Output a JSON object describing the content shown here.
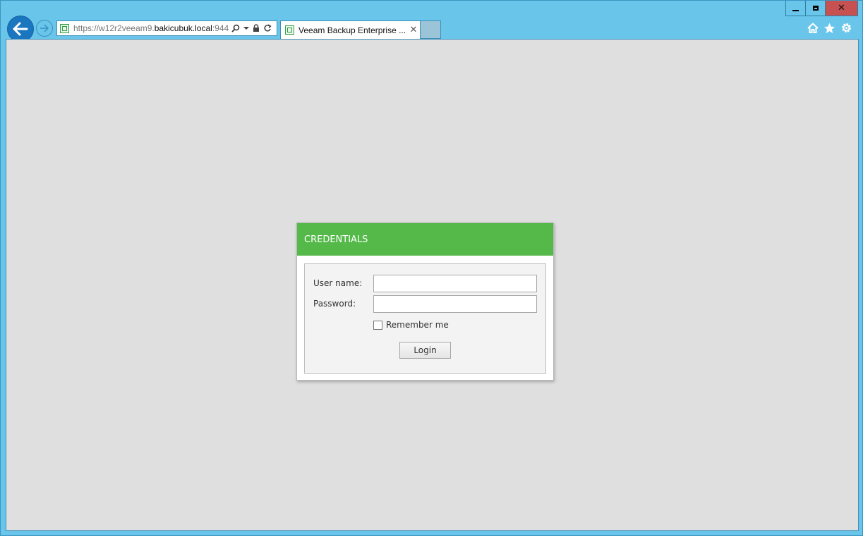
{
  "browser": {
    "address": {
      "scheme": "https://",
      "subdomain": "w12r2veeam9.",
      "host": "bakicubuk.local",
      "port": ":944"
    },
    "tab": {
      "title": "Veeam Backup Enterprise ...",
      "close_glyph": "✕"
    },
    "window_buttons": {
      "close_glyph": "✕"
    }
  },
  "login": {
    "header": "CREDENTIALS",
    "username_label": "User name:",
    "username_value": "",
    "password_label": "Password:",
    "password_value": "",
    "remember_label": "Remember me",
    "remember_checked": false,
    "login_button": "Login"
  },
  "colors": {
    "header_green": "#54b948",
    "frame_blue": "#69c6ea",
    "content_bg": "#dfdfdf",
    "close_red": "#c75050"
  },
  "icons": [
    "back-arrow-icon",
    "forward-arrow-icon",
    "site-favicon-icon",
    "search-icon",
    "dropdown-icon",
    "lock-icon",
    "refresh-icon",
    "home-icon",
    "star-icon",
    "gear-icon"
  ]
}
